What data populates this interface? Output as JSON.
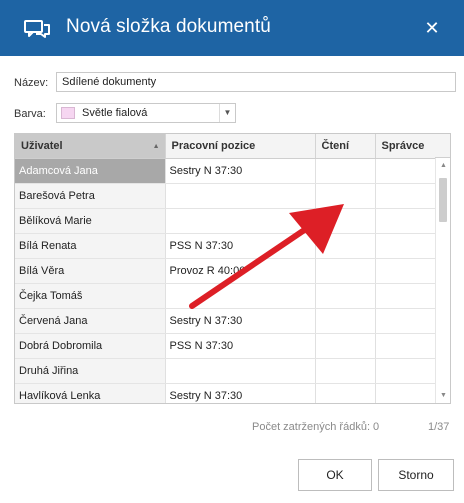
{
  "dialog": {
    "title": "Nová složka dokumentů",
    "close_label": "✕"
  },
  "form": {
    "name_label": "Název:",
    "name_value": "Sdílené dokumenty",
    "color_label": "Barva:",
    "color_value": "Světle fialová",
    "color_swatch": "#f6d6f1"
  },
  "grid": {
    "columns": [
      "Uživatel",
      "Pracovní pozice",
      "Čtení",
      "Správce"
    ],
    "rows": [
      {
        "user": "Adamcová Jana",
        "position": "Sestry N 37:30"
      },
      {
        "user": "Barešová Petra",
        "position": ""
      },
      {
        "user": "Bělíková Marie",
        "position": ""
      },
      {
        "user": "Bílá Renata",
        "position": "PSS N 37:30"
      },
      {
        "user": "Bílá Věra",
        "position": "Provoz R 40:00"
      },
      {
        "user": "Čejka Tomáš",
        "position": ""
      },
      {
        "user": "Červená Jana",
        "position": "Sestry N 37:30"
      },
      {
        "user": "Dobrá Dobromila",
        "position": "PSS N 37:30"
      },
      {
        "user": "Druhá Jiřina",
        "position": ""
      },
      {
        "user": "Havlíková Lenka",
        "position": "Sestry N 37:30"
      }
    ],
    "selected_row": "Adamcová Jana",
    "sorted_column": "Uživatel"
  },
  "footer": {
    "checked_rows": "Počet zatržených řádků: 0",
    "page": "1/37"
  },
  "buttons": {
    "ok": "OK",
    "cancel": "Storno"
  },
  "colors": {
    "titlebar": "#1e64a4",
    "annotation_arrow": "#dd1f26"
  }
}
